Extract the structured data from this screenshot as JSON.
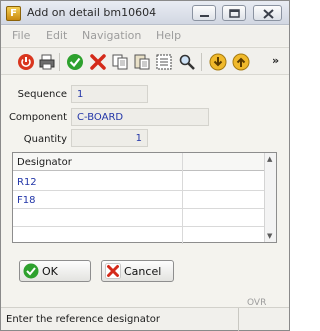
{
  "window": {
    "title": "Add on detail bm10604"
  },
  "menu": [
    "File",
    "Edit",
    "Navigation",
    "Help"
  ],
  "toolbar": {
    "icons": [
      "power-icon",
      "print-icon",
      "check-icon",
      "cancel-x-icon",
      "copy-icon",
      "paste-icon",
      "select-all-icon",
      "find-icon",
      "download-icon",
      "upload-icon"
    ],
    "more": "»"
  },
  "form": {
    "sequence_label": "Sequence",
    "sequence_value": "1",
    "component_label": "Component",
    "component_value": "C-BOARD",
    "quantity_label": "Quantity",
    "quantity_value": "1"
  },
  "grid": {
    "columns": [
      "Designator",
      ""
    ],
    "rows": [
      "R12",
      "F18"
    ]
  },
  "buttons": {
    "ok": "OK",
    "cancel": "Cancel"
  },
  "status": {
    "message": "Enter the reference designator",
    "mode": "OVR"
  },
  "colors": {
    "value_text": "#2336a8",
    "ok_green": "#2ea12e",
    "cancel_red": "#d42a1a"
  }
}
